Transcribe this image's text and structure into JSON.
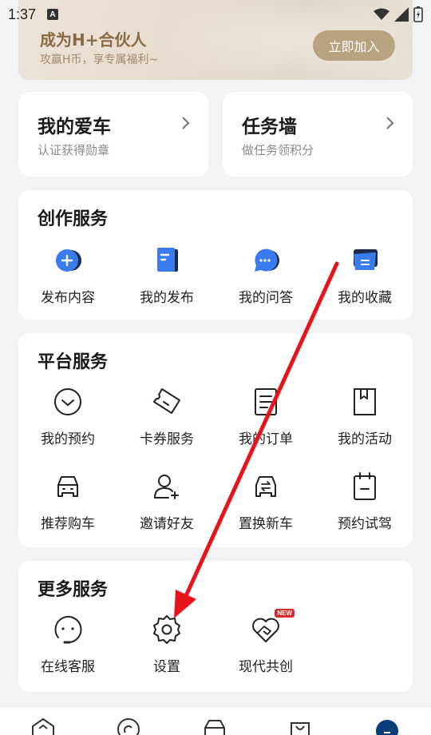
{
  "status_bar": {
    "time": "1:37",
    "notification_icon": "A"
  },
  "banner": {
    "title": "成为H+合伙人",
    "subtitle": "攻赢H币，享专属福利~",
    "button_label": "立即加入"
  },
  "my_car": {
    "title": "我的爱车",
    "subtitle": "认证获得勋章"
  },
  "task_wall": {
    "title": "任务墙",
    "subtitle": "做任务领积分"
  },
  "creation_services": {
    "title": "创作服务",
    "items": [
      {
        "label": "发布内容",
        "icon": "plus-bubble-icon"
      },
      {
        "label": "我的发布",
        "icon": "document-icon"
      },
      {
        "label": "我的问答",
        "icon": "chat-bubble-icon"
      },
      {
        "label": "我的收藏",
        "icon": "folder-icon"
      }
    ]
  },
  "platform_services": {
    "title": "平台服务",
    "items": [
      {
        "label": "我的预约",
        "icon": "clock-circle-icon"
      },
      {
        "label": "卡券服务",
        "icon": "ticket-icon"
      },
      {
        "label": "我的订单",
        "icon": "order-list-icon"
      },
      {
        "label": "我的活动",
        "icon": "bookmark-icon"
      },
      {
        "label": "推荐购车",
        "icon": "car-icon"
      },
      {
        "label": "邀请好友",
        "icon": "add-user-icon"
      },
      {
        "label": "置换新车",
        "icon": "car-exchange-icon"
      },
      {
        "label": "预约试驾",
        "icon": "calendar-icon"
      }
    ]
  },
  "more_services": {
    "title": "更多服务",
    "items": [
      {
        "label": "在线客服",
        "icon": "customer-service-icon"
      },
      {
        "label": "设置",
        "icon": "gear-icon"
      },
      {
        "label": "现代共创",
        "icon": "heart-handshake-icon",
        "badge": "NEW"
      }
    ]
  },
  "colors": {
    "accent_blue": "#3a7bf0",
    "banner_text": "#8a6a44",
    "banner_button": "#b9a27f",
    "annotation_arrow": "#e8141b"
  }
}
